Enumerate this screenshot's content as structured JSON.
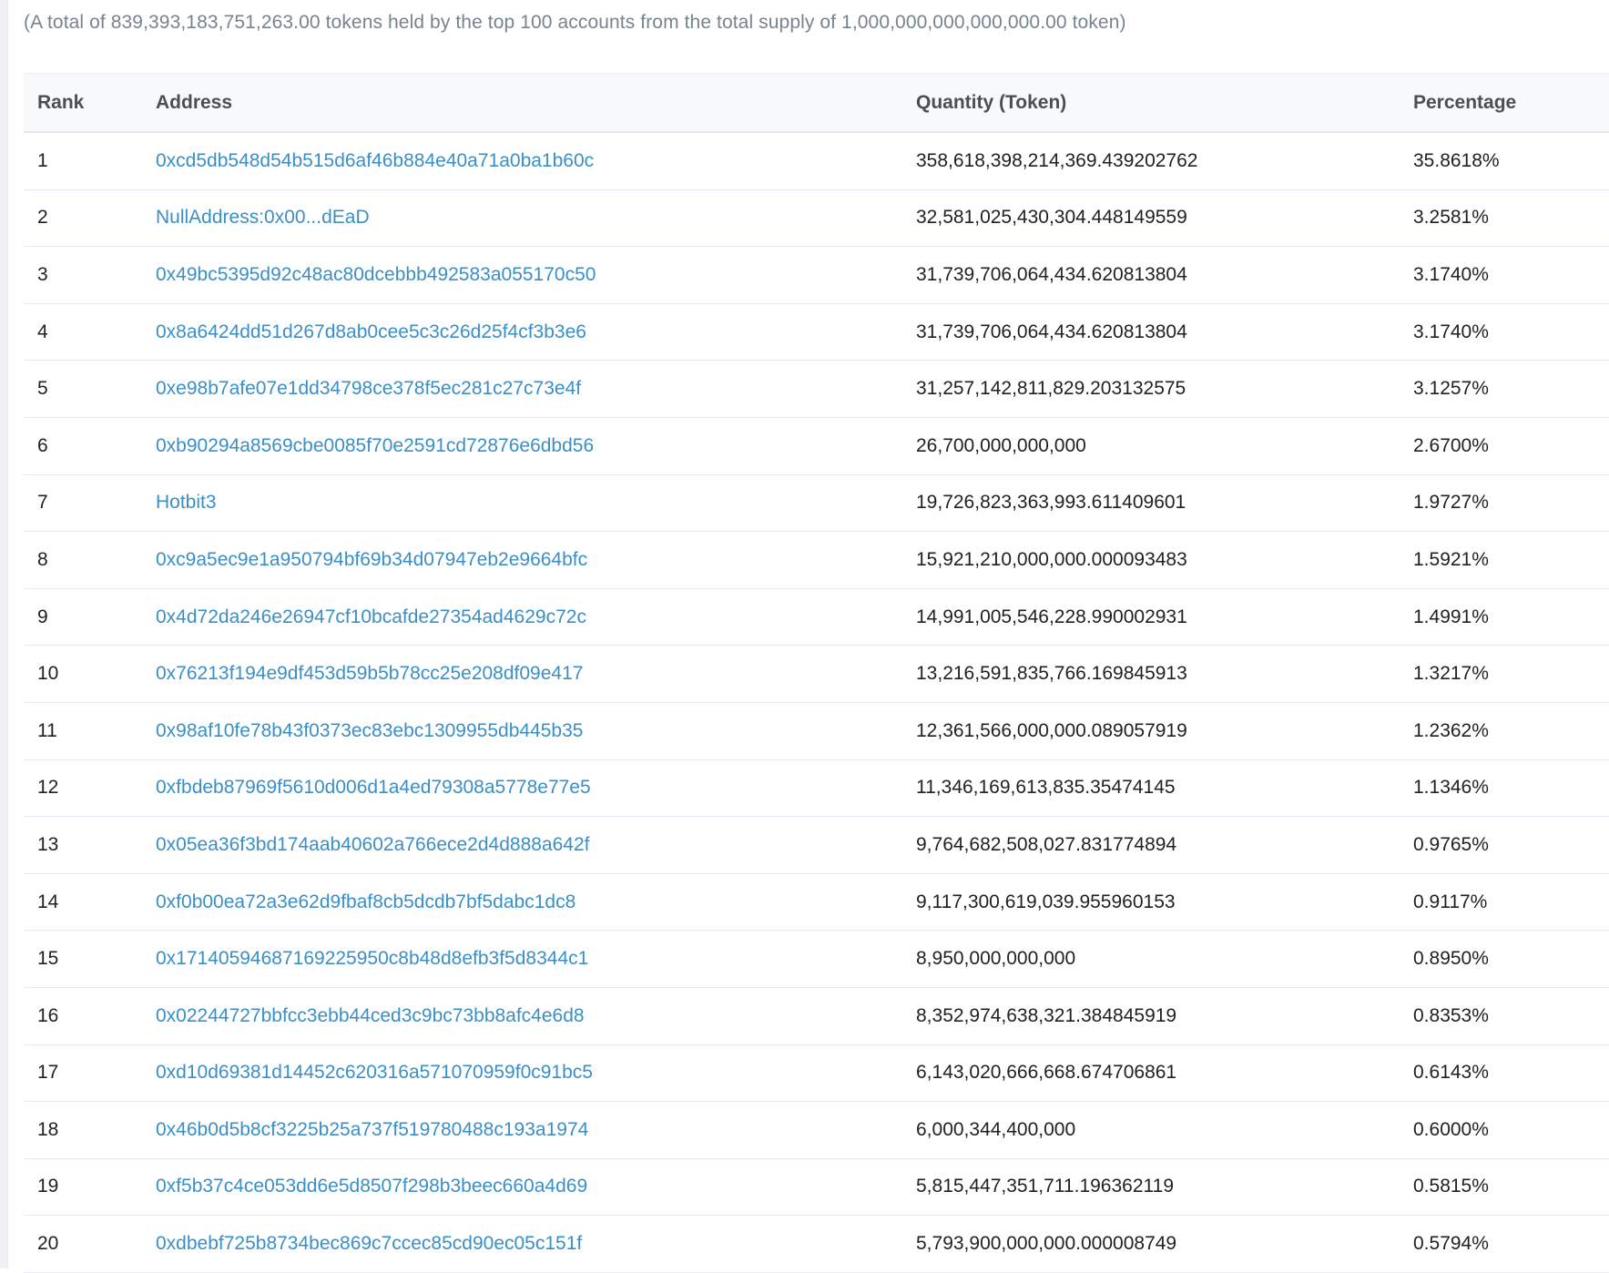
{
  "summary": "(A total of 839,393,183,751,263.00 tokens held by the top 100 accounts from the total supply of 1,000,000,000,000,000.00 token)",
  "table": {
    "headers": {
      "rank": "Rank",
      "address": "Address",
      "quantity": "Quantity (Token)",
      "percentage": "Percentage"
    },
    "rows": [
      {
        "rank": "1",
        "address": "0xcd5db548d54b515d6af46b884e40a71a0ba1b60c",
        "quantity": "358,618,398,214,369.439202762",
        "percentage": "35.8618%"
      },
      {
        "rank": "2",
        "address": "Null Address: 0x00...dEaD",
        "quantity": "32,581,025,430,304.448149559",
        "percentage": "3.2581%"
      },
      {
        "rank": "3",
        "address": "0x49bc5395d92c48ac80dcebbb492583a055170c50",
        "quantity": "31,739,706,064,434.620813804",
        "percentage": "3.1740%"
      },
      {
        "rank": "4",
        "address": "0x8a6424dd51d267d8ab0cee5c3c26d25f4cf3b3e6",
        "quantity": "31,739,706,064,434.620813804",
        "percentage": "3.1740%"
      },
      {
        "rank": "5",
        "address": "0xe98b7afe07e1dd34798ce378f5ec281c27c73e4f",
        "quantity": "31,257,142,811,829.203132575",
        "percentage": "3.1257%"
      },
      {
        "rank": "6",
        "address": "0xb90294a8569cbe0085f70e2591cd72876e6dbd56",
        "quantity": "26,700,000,000,000",
        "percentage": "2.6700%"
      },
      {
        "rank": "7",
        "address": "Hotbit 3",
        "quantity": "19,726,823,363,993.611409601",
        "percentage": "1.9727%"
      },
      {
        "rank": "8",
        "address": "0xc9a5ec9e1a950794bf69b34d07947eb2e9664bfc",
        "quantity": "15,921,210,000,000.000093483",
        "percentage": "1.5921%"
      },
      {
        "rank": "9",
        "address": "0x4d72da246e26947cf10bcafde27354ad4629c72c",
        "quantity": "14,991,005,546,228.990002931",
        "percentage": "1.4991%"
      },
      {
        "rank": "10",
        "address": "0x76213f194e9df453d59b5b78cc25e208df09e417",
        "quantity": "13,216,591,835,766.169845913",
        "percentage": "1.3217%"
      },
      {
        "rank": "11",
        "address": "0x98af10fe78b43f0373ec83ebc1309955db445b35",
        "quantity": "12,361,566,000,000.089057919",
        "percentage": "1.2362%"
      },
      {
        "rank": "12",
        "address": "0xfbdeb87969f5610d006d1a4ed79308a5778e77e5",
        "quantity": "11,346,169,613,835.35474145",
        "percentage": "1.1346%"
      },
      {
        "rank": "13",
        "address": "0x05ea36f3bd174aab40602a766ece2d4d888a642f",
        "quantity": "9,764,682,508,027.831774894",
        "percentage": "0.9765%"
      },
      {
        "rank": "14",
        "address": "0xf0b00ea72a3e62d9fbaf8cb5dcdb7bf5dabc1dc8",
        "quantity": "9,117,300,619,039.955960153",
        "percentage": "0.9117%"
      },
      {
        "rank": "15",
        "address": "0x1714059468716922595 0c8b48d8efb3f5d8344c1",
        "quantity": "8,950,000,000,000",
        "percentage": "0.8950%"
      },
      {
        "rank": "16",
        "address": "0x02244727bbfcc3ebb44ced3c9bc73bb8afc4e6d8",
        "quantity": "8,352,974,638,321.384845919",
        "percentage": "0.8353%"
      },
      {
        "rank": "17",
        "address": "0xd10d69381d14452c620316a571070959f0c91bc5",
        "quantity": "6,143,020,666,668.674706861",
        "percentage": "0.6143%"
      },
      {
        "rank": "18",
        "address": "0x46b0d5b8cf3225b25a737f519780488c193a1974",
        "quantity": "6,000,344,400,000",
        "percentage": "0.6000%"
      },
      {
        "rank": "19",
        "address": "0xf5b37c4ce053dd6e5d8507f298b3beec660a4d69",
        "quantity": "5,815,447,351,711.196362119",
        "percentage": "0.5815%"
      },
      {
        "rank": "20",
        "address": "0xdbebf725b8734bec869c7ccec85cd90ec05c151f",
        "quantity": "5,793,900,000,000.000008749",
        "percentage": "0.5794%"
      }
    ]
  }
}
